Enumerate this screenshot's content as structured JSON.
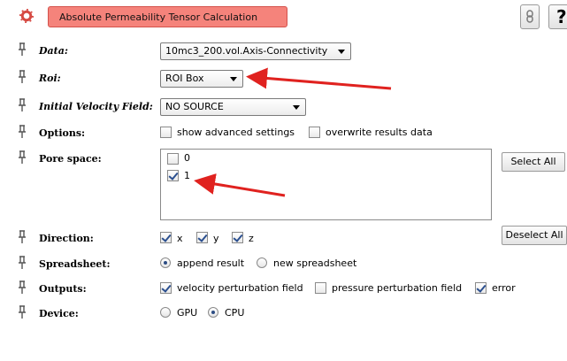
{
  "header": {
    "title": "Absolute Permeability Tensor Calculation",
    "top_buttons": [
      "link-icon",
      "help-icon"
    ],
    "help_label": "?"
  },
  "rows": {
    "data": {
      "label": "Data:",
      "value": "10mc3_200.vol.Axis-Connectivity"
    },
    "roi": {
      "label": "Roi:",
      "value": "ROI Box"
    },
    "velocity": {
      "label": "Initial Velocity Field:",
      "value": "NO SOURCE"
    },
    "options": {
      "label": "Options:",
      "items": [
        {
          "label": "show advanced settings",
          "checked": false
        },
        {
          "label": "overwrite results data",
          "checked": false
        }
      ]
    },
    "pore": {
      "label": "Pore space:",
      "items": [
        {
          "label": "0",
          "checked": false
        },
        {
          "label": "1",
          "checked": true
        }
      ],
      "select_all": "Select All",
      "deselect_all": "Deselect All"
    },
    "direction": {
      "label": "Direction:",
      "items": [
        {
          "label": "x",
          "checked": true
        },
        {
          "label": "y",
          "checked": true
        },
        {
          "label": "z",
          "checked": true
        }
      ]
    },
    "spreadsheet": {
      "label": "Spreadsheet:",
      "items": [
        {
          "label": "append result",
          "selected": true
        },
        {
          "label": "new spreadsheet",
          "selected": false
        }
      ]
    },
    "outputs": {
      "label": "Outputs:",
      "items": [
        {
          "label": "velocity perturbation field",
          "checked": true
        },
        {
          "label": "pressure perturbation field",
          "checked": false
        },
        {
          "label": "error",
          "checked": true
        }
      ]
    },
    "device": {
      "label": "Device:",
      "items": [
        {
          "label": "GPU",
          "selected": false
        },
        {
          "label": "CPU",
          "selected": true
        }
      ]
    }
  },
  "colors": {
    "title_bg": "#f5837b",
    "annotation_arrow": "#e0221f"
  }
}
